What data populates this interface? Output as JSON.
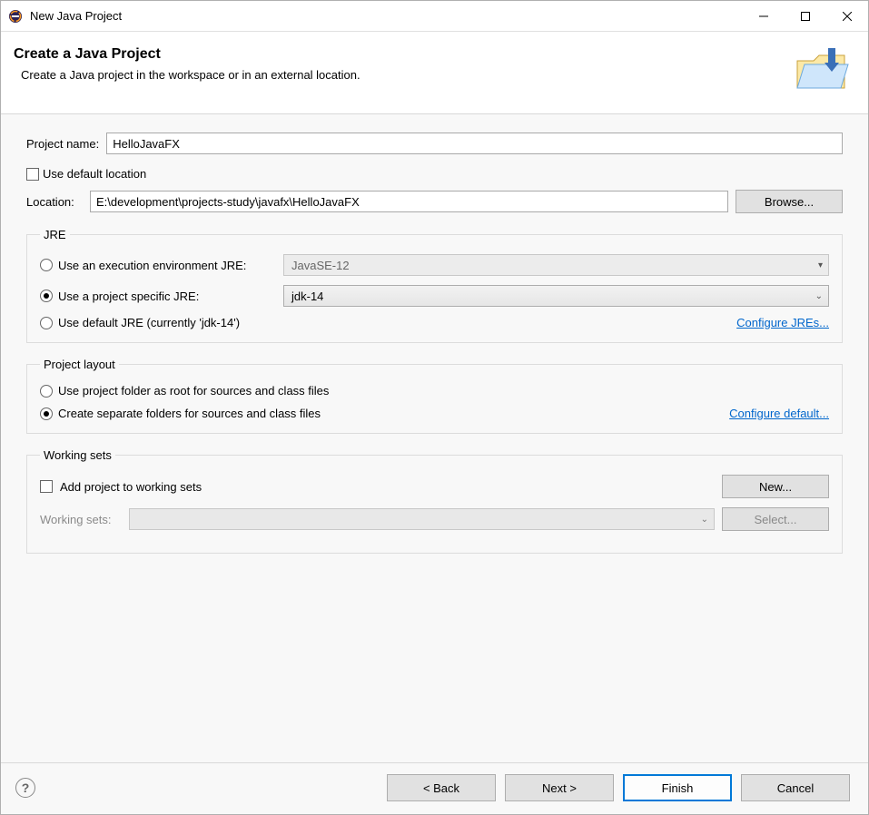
{
  "window": {
    "title": "New Java Project"
  },
  "header": {
    "title": "Create a Java Project",
    "subtitle": "Create a Java project in the workspace or in an external location."
  },
  "project_name": {
    "label": "Project name:",
    "value": "HelloJavaFX"
  },
  "use_default_location": {
    "label": "Use default location",
    "checked": false
  },
  "location": {
    "label": "Location:",
    "value": "E:\\development\\projects-study\\javafx\\HelloJavaFX",
    "browse": "Browse..."
  },
  "jre": {
    "legend": "JRE",
    "option_exec_env": "Use an execution environment JRE:",
    "exec_env_value": "JavaSE-12",
    "option_project_specific": "Use a project specific JRE:",
    "project_specific_value": "jdk-14",
    "option_default_jre": "Use default JRE (currently 'jdk-14')",
    "selected": "project_specific",
    "configure_link": "Configure JREs..."
  },
  "project_layout": {
    "legend": "Project layout",
    "option_root": "Use project folder as root for sources and class files",
    "option_separate": "Create separate folders for sources and class files",
    "selected": "separate",
    "configure_link": "Configure default..."
  },
  "working_sets": {
    "legend": "Working sets",
    "add_checkbox": "Add project to working sets",
    "add_checked": false,
    "new_btn": "New...",
    "label": "Working sets:",
    "select_btn": "Select..."
  },
  "footer": {
    "back": "< Back",
    "next": "Next >",
    "finish": "Finish",
    "cancel": "Cancel"
  }
}
